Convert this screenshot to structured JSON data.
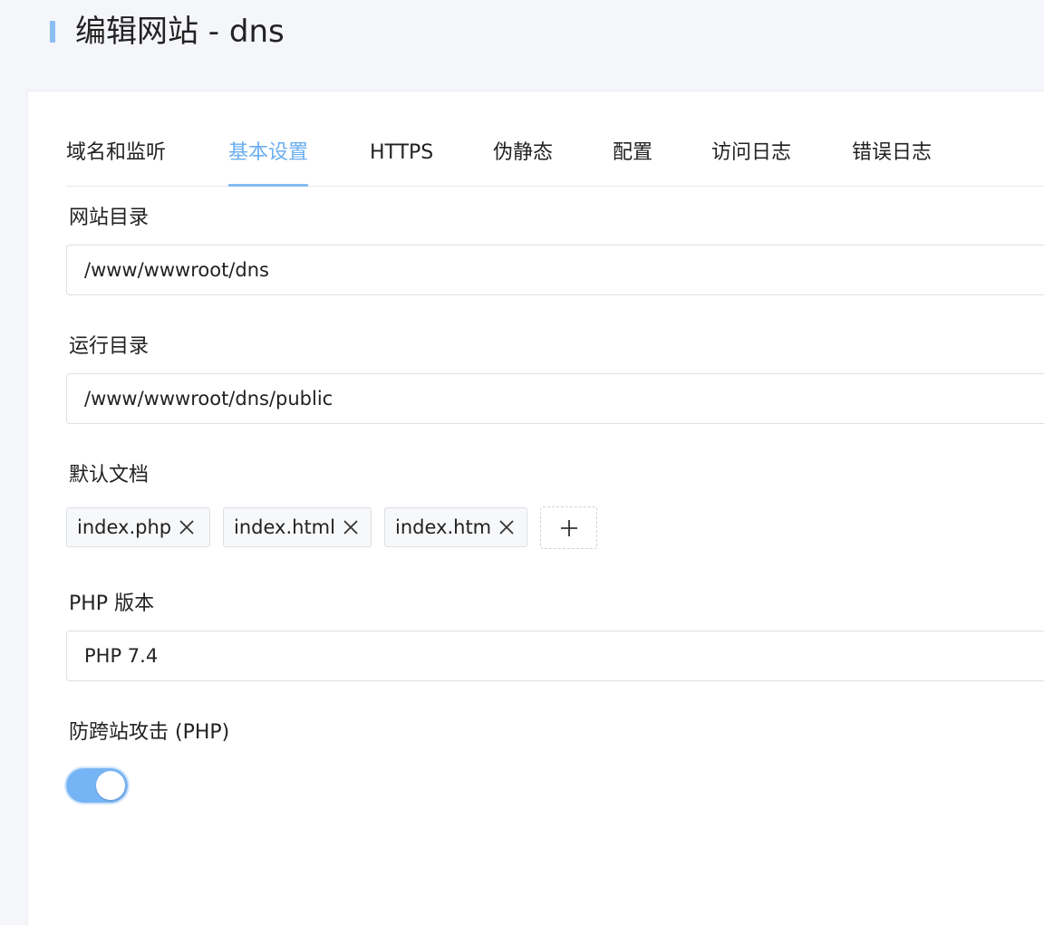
{
  "header": {
    "title": "编辑网站 - dns",
    "accent_color": "#8bbef4"
  },
  "tabs": [
    {
      "label": "域名和监听",
      "active": false
    },
    {
      "label": "基本设置",
      "active": true
    },
    {
      "label": "HTTPS",
      "active": false
    },
    {
      "label": "伪静态",
      "active": false
    },
    {
      "label": "配置",
      "active": false
    },
    {
      "label": "访问日志",
      "active": false
    },
    {
      "label": "错误日志",
      "active": false
    }
  ],
  "form": {
    "site_dir": {
      "label": "网站目录",
      "value": "/www/wwwroot/dns"
    },
    "run_dir": {
      "label": "运行目录",
      "value": "/www/wwwroot/dns/public"
    },
    "default_docs": {
      "label": "默认文档",
      "items": [
        "index.php",
        "index.html",
        "index.htm"
      ],
      "add_icon": "plus-icon",
      "remove_icon": "close-icon"
    },
    "php_version": {
      "label": "PHP 版本",
      "value": "PHP 7.4"
    },
    "anti_xss": {
      "label": "防跨站攻击 (PHP)",
      "enabled": true,
      "on_color": "#76b5f5"
    }
  },
  "colors": {
    "active_tab": "#6aaef0",
    "page_background": "#f5f6fa",
    "card_background": "#ffffff"
  }
}
